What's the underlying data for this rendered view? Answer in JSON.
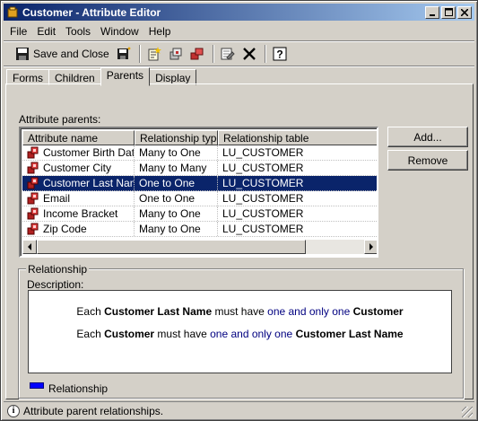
{
  "window": {
    "title": "Customer - Attribute Editor"
  },
  "menu": [
    "File",
    "Edit",
    "Tools",
    "Window",
    "Help"
  ],
  "toolbar": {
    "save_close_label": "Save and Close"
  },
  "tabs": [
    {
      "label": "Forms",
      "active": false
    },
    {
      "label": "Children",
      "active": false
    },
    {
      "label": "Parents",
      "active": true
    },
    {
      "label": "Display",
      "active": false
    }
  ],
  "parents": {
    "label": "Attribute parents:",
    "columns": [
      "Attribute name",
      "Relationship type",
      "Relationship table"
    ],
    "rows": [
      {
        "name": "Customer Birth Date",
        "type": "Many to One",
        "table": "LU_CUSTOMER",
        "selected": false
      },
      {
        "name": "Customer City",
        "type": "Many to Many",
        "table": "LU_CUSTOMER",
        "selected": false
      },
      {
        "name": "Customer Last Name",
        "type": "One to One",
        "table": "LU_CUSTOMER",
        "selected": true
      },
      {
        "name": "Email",
        "type": "One to One",
        "table": "LU_CUSTOMER",
        "selected": false
      },
      {
        "name": "Income Bracket",
        "type": "Many to One",
        "table": "LU_CUSTOMER",
        "selected": false
      },
      {
        "name": "Zip Code",
        "type": "Many to One",
        "table": "LU_CUSTOMER",
        "selected": false
      }
    ]
  },
  "buttons": {
    "add": "Add...",
    "remove": "Remove"
  },
  "relationship": {
    "group_label": "Relationship",
    "description_label": "Description:",
    "line1": {
      "pre": "Each ",
      "subject": "Customer Last Name",
      "mid": " must have ",
      "quantity": "one and only one",
      "object": "Customer"
    },
    "line2": {
      "pre": "Each ",
      "subject": "Customer",
      "mid": " must have ",
      "quantity": "one and only one",
      "object": "Customer Last Name"
    },
    "legend_label": "Relationship"
  },
  "status": {
    "text": "Attribute parent relationships."
  },
  "colors": {
    "selection": "#0a246a",
    "relationship_blue": "#000080",
    "legend_blue": "#0000ff"
  }
}
